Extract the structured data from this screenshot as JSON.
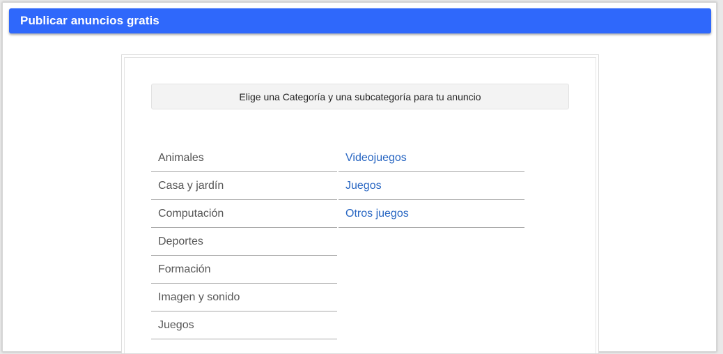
{
  "header": {
    "title": "Publicar anuncios gratis"
  },
  "instruction": {
    "text": "Elige una Categoría y una subcategoría para tu anuncio"
  },
  "categories": [
    {
      "label": "Animales"
    },
    {
      "label": "Casa y jardín"
    },
    {
      "label": "Computación"
    },
    {
      "label": "Deportes"
    },
    {
      "label": "Formación"
    },
    {
      "label": "Imagen y sonido"
    },
    {
      "label": "Juegos"
    }
  ],
  "subcategories": [
    {
      "label": "Videojuegos"
    },
    {
      "label": "Juegos"
    },
    {
      "label": "Otros juegos"
    }
  ],
  "colors": {
    "header_bg": "#2f68fb",
    "header_text": "#ffffff",
    "category_text": "#555555",
    "subcategory_link": "#2866c2",
    "divider": "#a9a9a9",
    "instruction_bg": "#f3f3f3"
  }
}
